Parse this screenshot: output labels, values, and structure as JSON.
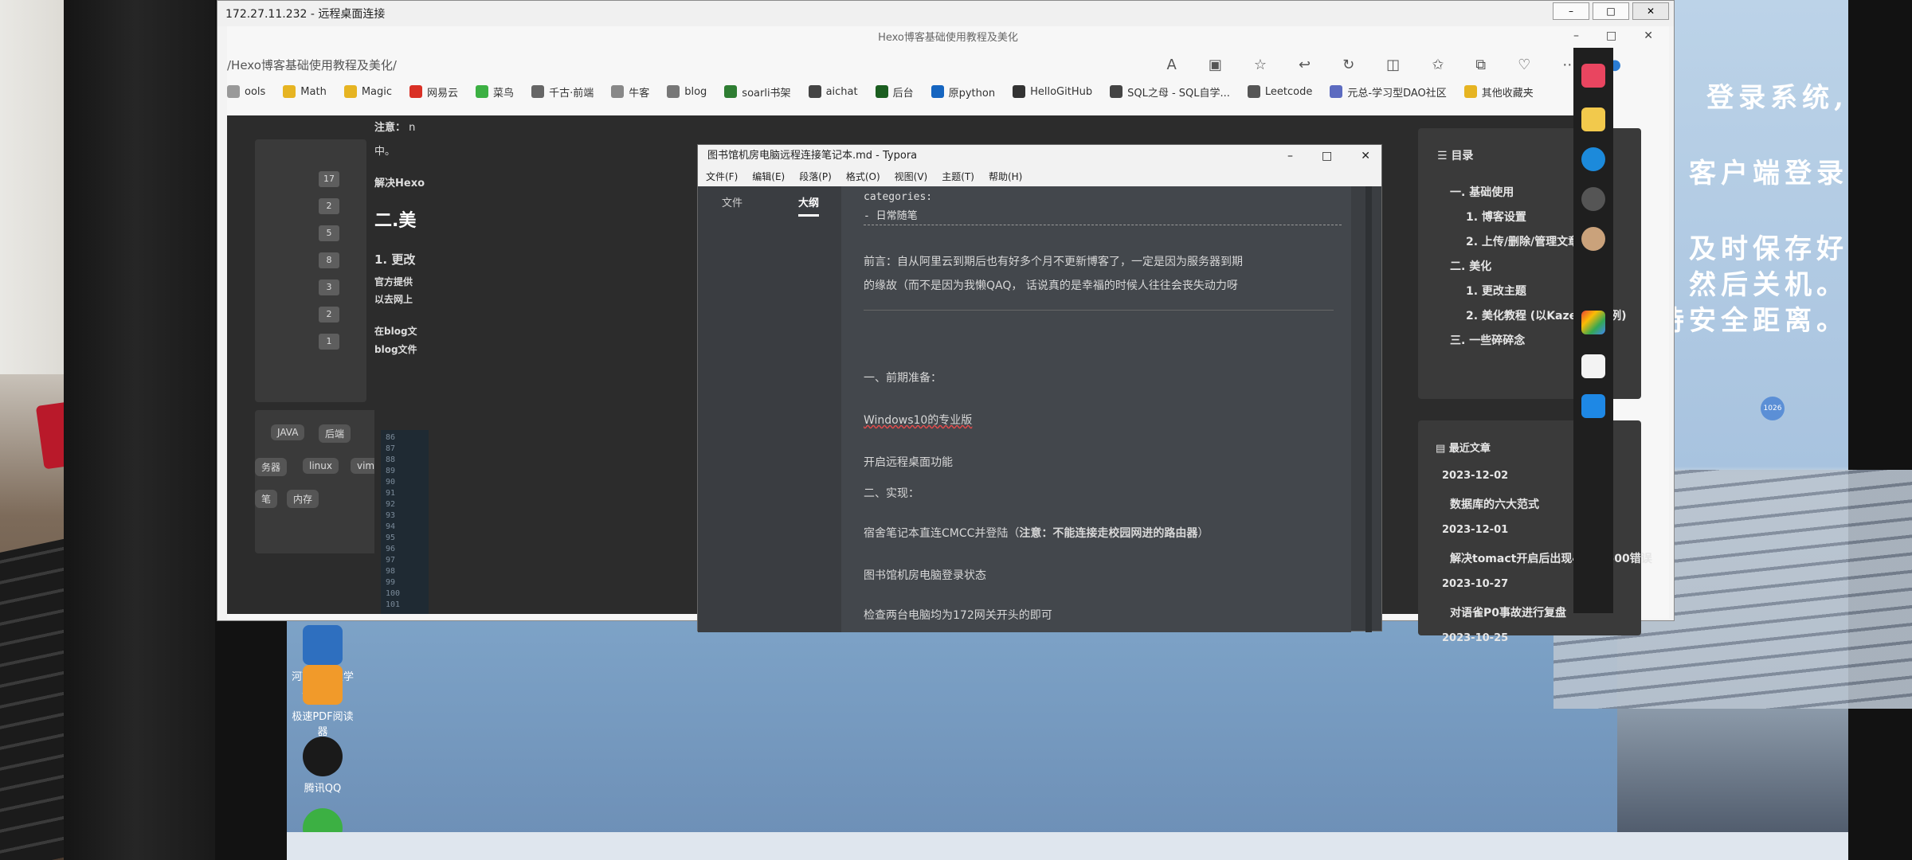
{
  "rdp": {
    "title": "172.27.11.232 - 远程桌面连接"
  },
  "browser": {
    "tab_title": "Hexo博客基础使用教程及美化",
    "address": "/Hexo博客基础使用教程及美化/",
    "bookmarks": [
      "ools",
      "Math",
      "Magic",
      "网易云",
      "菜鸟",
      "千古·前端",
      "牛客",
      "blog",
      "soarli书架",
      "aichat",
      "后台",
      "原python",
      "HelloGitHub",
      "SQL之母 - SQL自学...",
      "Leetcode",
      "元总-学习型DAO社区",
      "其他收藏夹"
    ]
  },
  "blog": {
    "note_bold": "注意：",
    "note_n": "n",
    "zhong": "中。",
    "solve": "解决Hexo",
    "h2": "二.美",
    "h3": "1. 更改",
    "p1": "官方提供",
    "p2": "以去网上",
    "p3": "在blog文",
    "p4": "blog文件",
    "counts": [
      "17",
      "2",
      "5",
      "8",
      "3",
      "2",
      "1"
    ],
    "tags": [
      "JAVA",
      "后端",
      "务器",
      "linux",
      "vim",
      "笔",
      "内存"
    ],
    "code_lines": [
      "86",
      "87",
      "88",
      "89",
      "90",
      "91",
      "92",
      "93",
      "94",
      "95",
      "96",
      "97",
      "98",
      "99",
      "100",
      "101"
    ]
  },
  "typora": {
    "title": "图书馆机房电脑远程连接笔记本.md - Typora",
    "menu": [
      "文件(F)",
      "编辑(E)",
      "段落(P)",
      "格式(O)",
      "视图(V)",
      "主题(T)",
      "帮助(H)"
    ],
    "tabs": [
      "文件",
      "大纲"
    ],
    "doc": {
      "categories": "categories:",
      "category_value": "- 日常随笔",
      "preface_1": "前言：自从阿里云到期后也有好多个月不更新博客了，一定是因为服务器到期",
      "preface_2": "的缘故（而不是因为我懒QAQ，   话说真的是幸福的时候人往往会丧失动力呀",
      "section1": "一、前期准备：",
      "windows": "Windows10的专业版",
      "remote": "开启远程桌面功能",
      "section2": "二、实现：",
      "step1_a": "宿舍笔记本直连CMCC并登陆（",
      "step1_b": "注意：不能连接走校园网进的路由器",
      "step1_c": "）",
      "step2": "图书馆机房电脑登录状态",
      "step3": "检查两台电脑均为172网关开头的即可"
    }
  },
  "toc": {
    "title": "目录",
    "items": [
      "一. 基础使用",
      "1. 博客设置",
      "2. 上传/删除/管理文章",
      "二. 美化",
      "1. 更改主题",
      "2. 美化教程 (以Kaze主题为例)",
      "三. 一些碎碎念"
    ]
  },
  "recent": {
    "title": "最近文章",
    "entries": [
      {
        "date": "2023-12-02",
        "title": "数据库的六大范式"
      },
      {
        "date": "2023-12-01",
        "title": "解决tomact开启后出现404和500错误"
      },
      {
        "date": "2023-10-27",
        "title": "对语雀P0事故进行复盘"
      },
      {
        "date": "2023-10-25",
        "title": ""
      }
    ]
  },
  "badge_1026": "1026",
  "wall_text": [
    "登录系统,",
    "客户端登录",
    "及时保存好",
    "然后关机。",
    "持安全距离。"
  ],
  "desktop_icons": [
    {
      "label": "河南农业大学校园网..."
    },
    {
      "label": "极速PDF阅读器"
    },
    {
      "label": "腾讯QQ"
    }
  ]
}
